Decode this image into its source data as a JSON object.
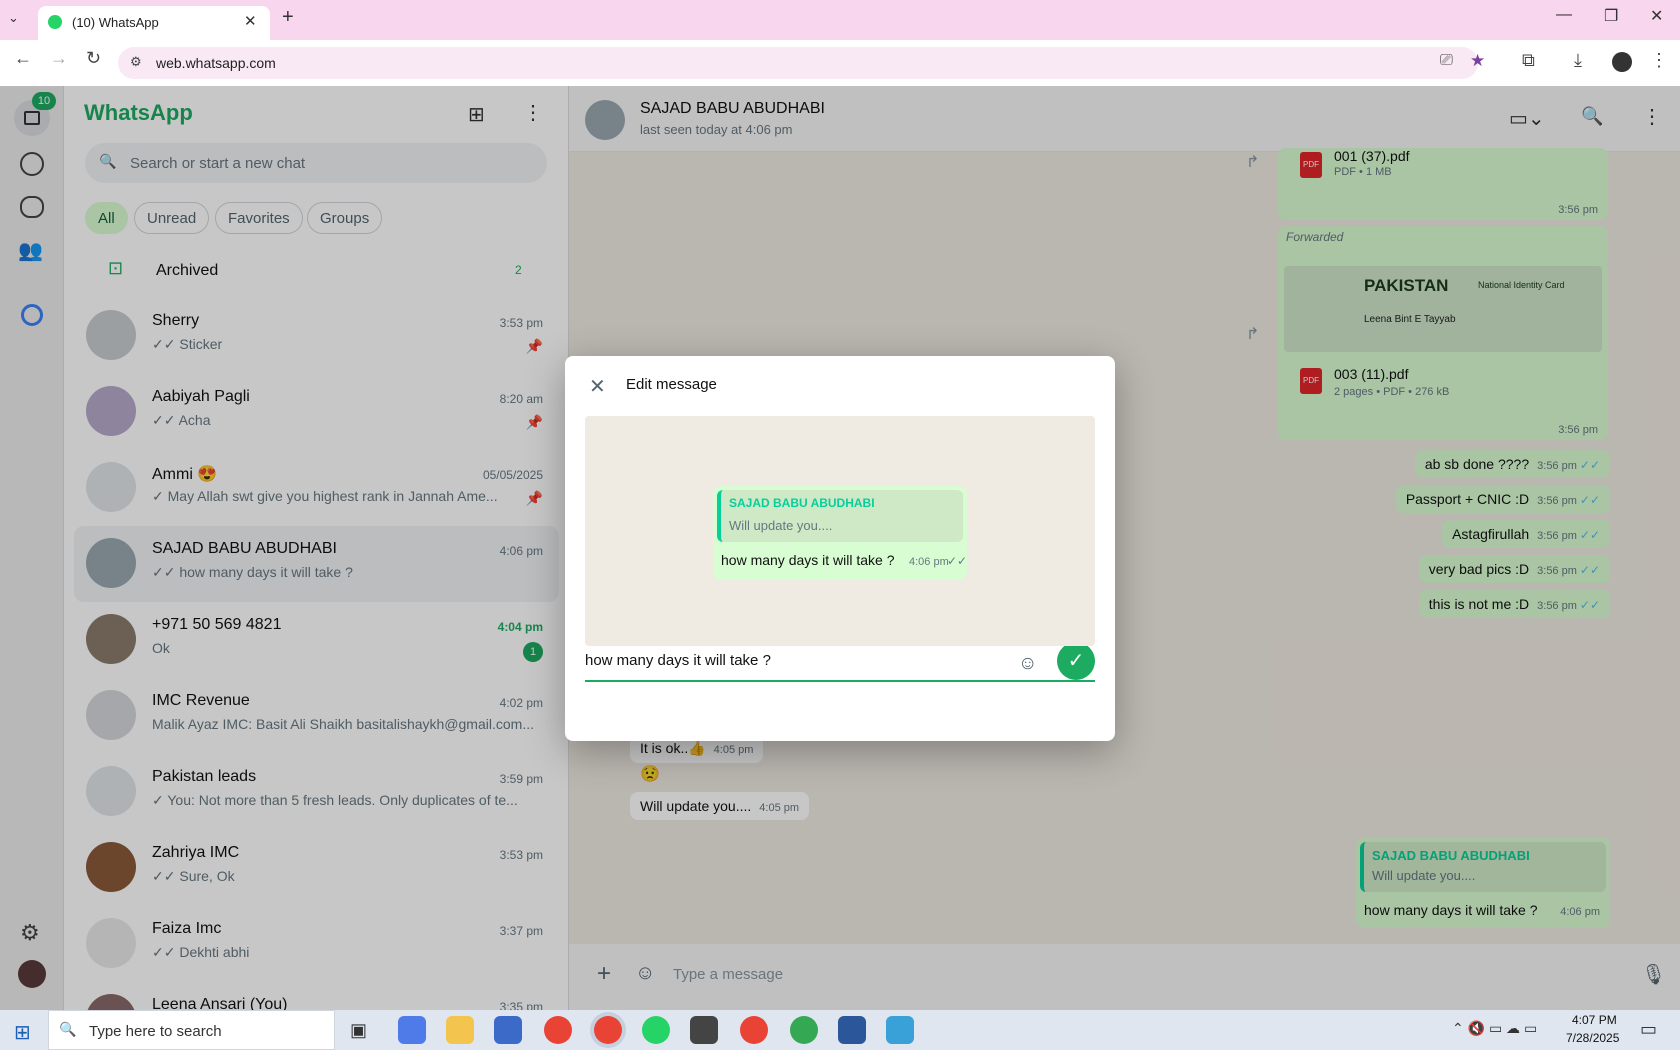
{
  "browser": {
    "tab_title": "(10) WhatsApp",
    "url": "web.whatsapp.com"
  },
  "rail": {
    "badge": "10"
  },
  "sidebar": {
    "title": "WhatsApp",
    "search_placeholder": "Search or start a new chat",
    "filters": [
      "All",
      "Unread",
      "Favorites",
      "Groups"
    ],
    "archived_label": "Archived",
    "archived_count": "2",
    "chats": [
      {
        "name": "Sherry",
        "preview": "✓✓ Sticker",
        "time": "3:53 pm"
      },
      {
        "name": "Aabiyah Pagli",
        "preview": "✓✓ Acha",
        "time": "8:20 am"
      },
      {
        "name": "Ammi 😍",
        "preview": "✓ May Allah swt give you highest rank in Jannah  Ame...",
        "time": "05/05/2025"
      },
      {
        "name": "SAJAD BABU ABUDHABI",
        "preview": "✓✓ how many days it will take ?",
        "time": "4:06 pm"
      },
      {
        "name": "+971 50 569 4821",
        "preview": "Ok",
        "time": "4:04 pm",
        "unread": "1"
      },
      {
        "name": "IMC Revenue",
        "preview": "Malik Ayaz IMC: Basit Ali Shaikh basitalishaykh@gmail.com...",
        "time": "4:02 pm"
      },
      {
        "name": "Pakistan leads",
        "preview": "✓ You: Not more than 5  fresh leads. Only duplicates of te...",
        "time": "3:59 pm"
      },
      {
        "name": "Zahriya IMC",
        "preview": "✓✓ Sure, Ok",
        "time": "3:53 pm"
      },
      {
        "name": "Faiza Imc",
        "preview": "✓✓ Dekhti abhi",
        "time": "3:37 pm"
      },
      {
        "name": "Leena Ansari (You)",
        "preview": "",
        "time": "3:35 pm"
      }
    ]
  },
  "chat": {
    "contact_name": "SAJAD BABU ABUDHABI",
    "status": "last seen today at 4:06 pm",
    "file1": {
      "name": "001 (37).pdf",
      "meta": "PDF • 1 MB",
      "time": "3:56 pm"
    },
    "forwarded": "Forwarded",
    "card_title": "PAKISTAN",
    "card_sub": "National Identity Card",
    "card_name": "Leena Bint E Tayyab",
    "file2": {
      "name": "003 (11).pdf",
      "meta": "2 pages • PDF • 276 kB",
      "time": "3:56 pm"
    },
    "outgoing": [
      {
        "text": "ab sb done ????",
        "time": "3:56 pm"
      },
      {
        "text": "Passport + CNIC :D",
        "time": "3:56 pm"
      },
      {
        "text": "Astagfirullah",
        "time": "3:56 pm"
      },
      {
        "text": "very bad pics :D",
        "time": "3:56 pm"
      },
      {
        "text": "this is not me :D",
        "time": "3:56 pm"
      }
    ],
    "incoming": [
      {
        "text": "It is ok..👍",
        "time": "4:05 pm"
      },
      {
        "text": "😟",
        "time": ""
      },
      {
        "text": "Will update you....",
        "time": "4:05 pm"
      }
    ],
    "reply": {
      "quote_name": "SAJAD BABU ABUDHABI",
      "quote_text": "Will update you....",
      "text": "how many days it will take ?",
      "time": "4:06 pm"
    },
    "composer_placeholder": "Type a message"
  },
  "modal": {
    "title": "Edit message",
    "quote_name": "SAJAD BABU ABUDHABI",
    "quote_text": "Will update you....",
    "message": "how many days it will take ?",
    "time": "4:06 pm",
    "input_value": "how many days it will take ?"
  },
  "taskbar": {
    "search_placeholder": "Type here to search",
    "time": "4:07 PM",
    "date": "7/28/2025"
  },
  "colors": {
    "accent": "#25d366",
    "brand": "#1daa61",
    "bubble_out": "#d9fdd3"
  }
}
